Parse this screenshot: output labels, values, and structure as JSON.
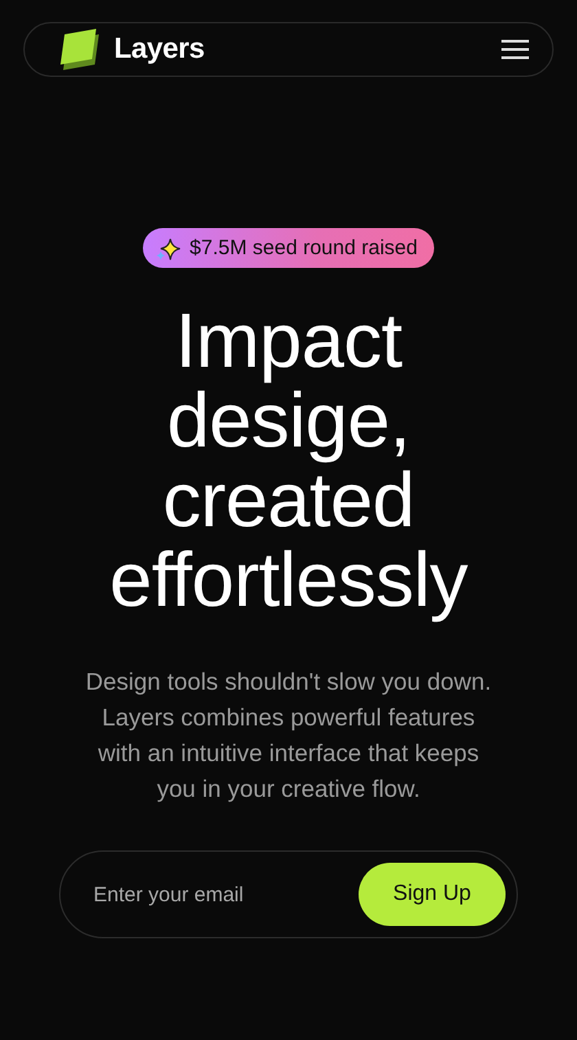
{
  "nav": {
    "brand": "Layers"
  },
  "badge": {
    "text": "$7.5M seed round raised"
  },
  "headline": "Impact desige, created effortlessly",
  "description": "Design tools shouldn't slow you down. Layers combines powerful features with an intuitive interface that keeps you in your creative flow.",
  "signup": {
    "placeholder": "Enter your email",
    "button": "Sign Up"
  }
}
